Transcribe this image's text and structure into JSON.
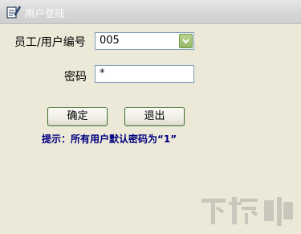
{
  "window": {
    "title": "用户登陆",
    "icon": "login-app-icon"
  },
  "form": {
    "user_label": "员工/用户编号",
    "user_value": "005",
    "password_label": "密码",
    "password_value": "*"
  },
  "buttons": {
    "ok_label": "确定",
    "exit_label": "退出"
  },
  "hint": "提示：所有用户默认密码为“1”",
  "watermark": {
    "text": "下载吧",
    "color": "#8a8a8a"
  },
  "colors": {
    "background": "#ece9d8",
    "hint": "#00007f",
    "combo_button": "#93b869"
  }
}
